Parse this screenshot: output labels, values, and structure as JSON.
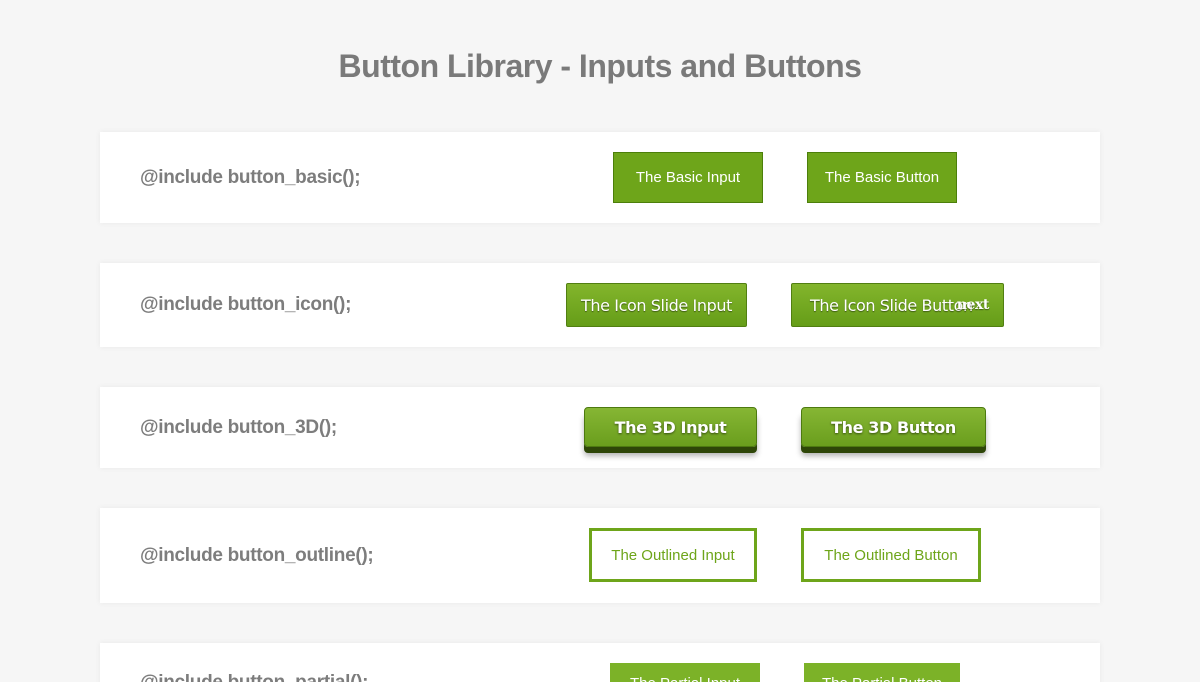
{
  "page": {
    "title": "Button Library - Inputs and Buttons"
  },
  "sections": [
    {
      "label": "@include button_basic();",
      "input_label": "The Basic Input",
      "button_label": "The Basic Button"
    },
    {
      "label": "@include button_icon();",
      "input_label": "The Icon Slide Input",
      "button_label": "The Icon Slide Button",
      "button_icon_text": "next"
    },
    {
      "label": "@include button_3D();",
      "input_label": "The 3D Input",
      "button_label": "The 3D Button"
    },
    {
      "label": "@include button_outline();",
      "input_label": "The Outlined Input",
      "button_label": "The Outlined Button"
    },
    {
      "label": "@include button_partial();",
      "input_label": "The Partial Input",
      "button_label": "The Partial Button"
    }
  ],
  "colors": {
    "accent": "#6ea51a",
    "background": "#f6f6f6",
    "card": "#ffffff",
    "text": "#7d7d7d"
  }
}
